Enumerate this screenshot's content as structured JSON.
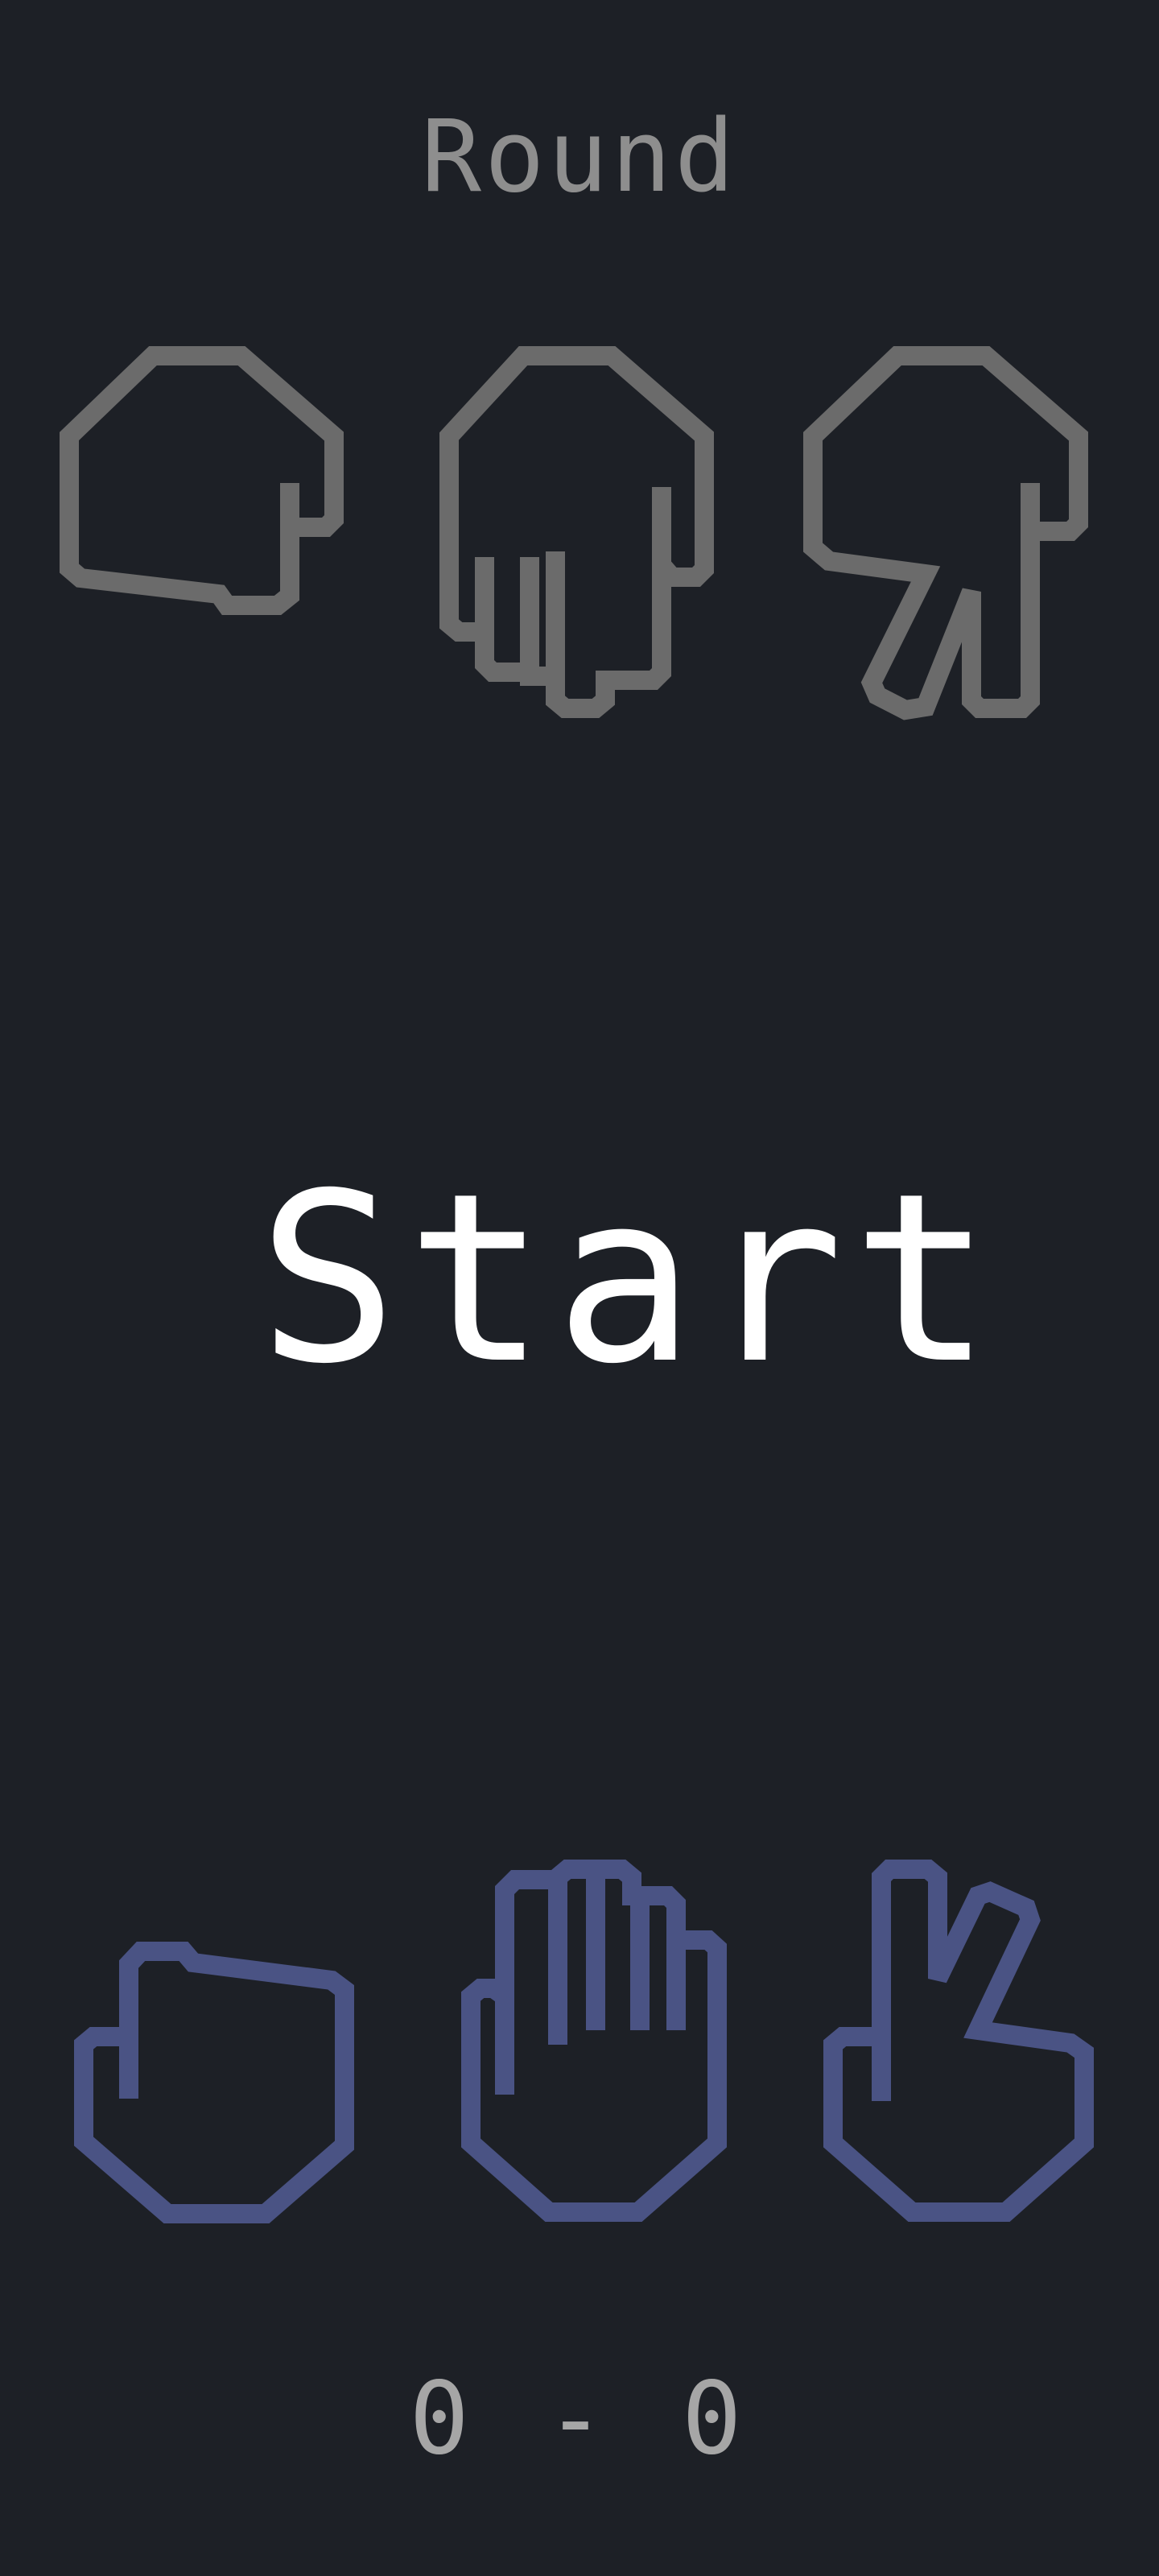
{
  "header": {
    "round_label": "Round"
  },
  "opponent": {
    "hands": [
      {
        "icon": "rock-hand-down-icon"
      },
      {
        "icon": "paper-hand-down-icon"
      },
      {
        "icon": "scissors-hand-down-icon"
      }
    ],
    "color": "#6b6b6b"
  },
  "center": {
    "start_label": "Start"
  },
  "player": {
    "hands": [
      {
        "icon": "rock-hand-icon"
      },
      {
        "icon": "paper-hand-icon"
      },
      {
        "icon": "scissors-hand-icon"
      }
    ],
    "color": "#4a5384"
  },
  "score": {
    "text": "0 - 0"
  },
  "colors": {
    "background": "#1d2026",
    "start_text": "#ffffff",
    "round_text": "#8e8e8e",
    "score_text": "#a6a6a6"
  }
}
